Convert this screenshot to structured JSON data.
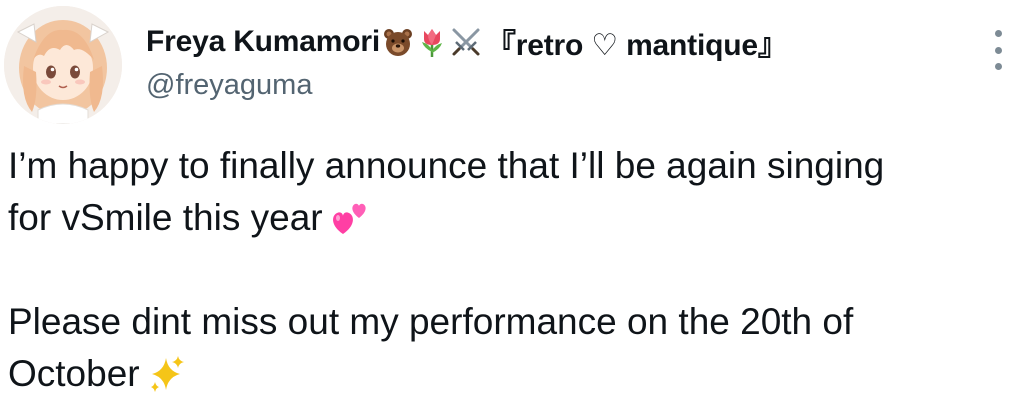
{
  "author": {
    "display_name": "Freya Kumamori",
    "name_emojis": [
      "bear-face-emoji",
      "tulip-emoji",
      "crossed-swords-emoji"
    ],
    "name_suffix": "『retro ♡ mantique』",
    "handle": "@freyaguma",
    "avatar": "anime-girl-avatar"
  },
  "tweet": {
    "line1": "I’m happy to finally announce that I’ll be again singing",
    "line2": "for vSmile  this year",
    "line2_emoji": "two-hearts-emoji",
    "line3": "Please dint miss out my performance on the 20th of",
    "line4": "October",
    "line4_emoji": "sparkles-emoji"
  },
  "menu": {
    "icon": "more-vertical-icon"
  },
  "colors": {
    "text": "#0f1419",
    "secondary": "#536471",
    "icon": "#7d8b95",
    "heart": "#ff3fa4",
    "sparkle": "#f5c518"
  }
}
